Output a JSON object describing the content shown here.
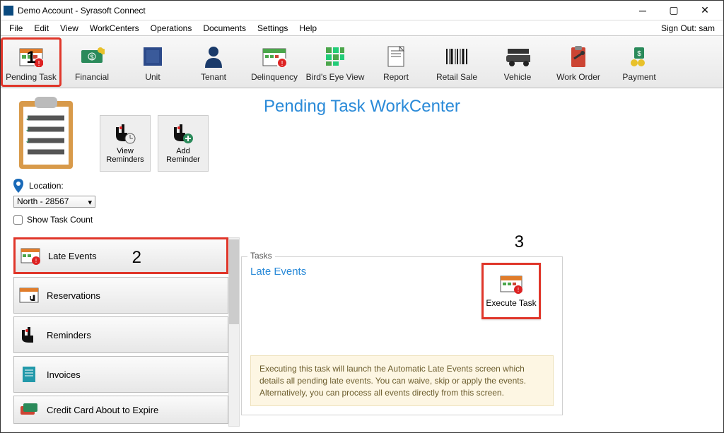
{
  "window": {
    "title": "Demo Account - Syrasoft Connect"
  },
  "signout": "Sign Out: sam",
  "menu": {
    "items": [
      "File",
      "Edit",
      "View",
      "WorkCenters",
      "Operations",
      "Documents",
      "Settings",
      "Help"
    ]
  },
  "ribbon": {
    "items": [
      {
        "label": "Pending Task",
        "icon": "calendar-alert"
      },
      {
        "label": "Financial",
        "icon": "dollar-card"
      },
      {
        "label": "Unit",
        "icon": "unit"
      },
      {
        "label": "Tenant",
        "icon": "person"
      },
      {
        "label": "Delinquency",
        "icon": "calendar-warn"
      },
      {
        "label": "Bird's Eye View",
        "icon": "grid"
      },
      {
        "label": "Report",
        "icon": "document"
      },
      {
        "label": "Retail Sale",
        "icon": "barcode"
      },
      {
        "label": "Vehicle",
        "icon": "car"
      },
      {
        "label": "Work Order",
        "icon": "wrench-clip"
      },
      {
        "label": "Payment",
        "icon": "coins"
      }
    ]
  },
  "page_title": "Pending Task WorkCenter",
  "secondary": {
    "view_reminders": "View\nReminders",
    "add_reminder": "Add\nReminder"
  },
  "location": {
    "label": "Location:",
    "value": "North - 28567"
  },
  "show_task_count_label": "Show Task Count",
  "task_list": [
    {
      "label": "Late Events",
      "icon": "calendar-alert"
    },
    {
      "label": "Reservations",
      "icon": "calendar-hand"
    },
    {
      "label": "Reminders",
      "icon": "hand"
    },
    {
      "label": "Invoices",
      "icon": "invoice"
    },
    {
      "label": "Credit Card About to Expire",
      "icon": "cards"
    }
  ],
  "tasks_panel": {
    "header": "Tasks",
    "title": "Late Events",
    "execute_label": "Execute Task",
    "description": "Executing this task will launch the Automatic Late Events screen which details all pending late events.  You can waive, skip or apply the events.  Alternatively, you can process all events directly from this screen."
  },
  "callouts": {
    "one": "1",
    "two": "2",
    "three": "3"
  }
}
